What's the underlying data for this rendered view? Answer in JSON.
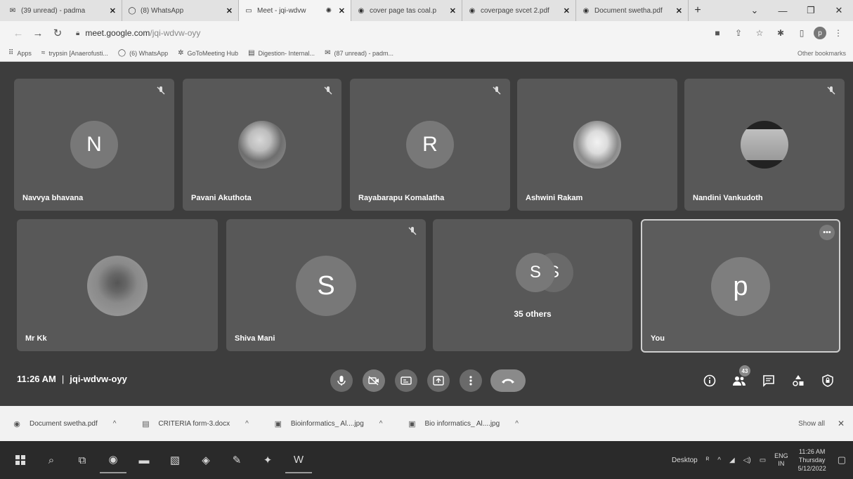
{
  "browser": {
    "tabs": [
      {
        "icon": "mail-icon",
        "label": "(39 unread) - padma",
        "close": "✕",
        "active": false
      },
      {
        "icon": "whatsapp-icon",
        "label": "(8) WhatsApp",
        "close": "✕",
        "active": false
      },
      {
        "icon": "meet-icon",
        "label": "Meet - jqi-wdvw",
        "close": "✕",
        "active": true
      },
      {
        "icon": "globe-icon",
        "label": "cover page tas coal.p",
        "close": "✕",
        "active": false
      },
      {
        "icon": "globe-icon",
        "label": "coverpage svcet 2.pdf",
        "close": "✕",
        "active": false
      },
      {
        "icon": "globe-icon",
        "label": "Document swetha.pdf",
        "close": "✕",
        "active": false
      }
    ],
    "new_tab": "+",
    "url_host": "meet.google.com",
    "url_path": "/jqi-wdvw-oyy",
    "profile_letter": "p",
    "bookmarks": [
      {
        "icon": "apps-icon",
        "label": "Apps"
      },
      {
        "icon": "link-icon",
        "label": "trypsin [Anaerofusti..."
      },
      {
        "icon": "whatsapp-icon",
        "label": "(6) WhatsApp"
      },
      {
        "icon": "gotomeeting-icon",
        "label": "GoToMeeting Hub"
      },
      {
        "icon": "doc-icon",
        "label": "Digestion- Internal..."
      },
      {
        "icon": "mail-icon",
        "label": "(87 unread) - padm..."
      }
    ],
    "other_bookmarks": "Other bookmarks"
  },
  "meet": {
    "participants": [
      {
        "name": "Navvya bhavana",
        "letter": "N",
        "type": "letter",
        "muted": true
      },
      {
        "name": "Pavani Akuthota",
        "letter": "",
        "type": "photo",
        "muted": true
      },
      {
        "name": "Rayabarapu Komalatha",
        "letter": "R",
        "type": "letter",
        "muted": true
      },
      {
        "name": "Ashwini Rakam",
        "letter": "",
        "type": "photo",
        "muted": false
      },
      {
        "name": "Nandini Vankudoth",
        "letter": "",
        "type": "photo",
        "muted": true
      },
      {
        "name": "Mr Kk",
        "letter": "",
        "type": "photo",
        "muted": false
      },
      {
        "name": "Shiva Mani",
        "letter": "S",
        "type": "letter",
        "muted": true
      }
    ],
    "others": {
      "letters": [
        "S",
        "S"
      ],
      "label": "35 others"
    },
    "self": {
      "name": "You",
      "letter": "p",
      "more": "•••"
    },
    "time": "11:26 AM",
    "separator": "|",
    "meeting_code": "jqi-wdvw-oyy",
    "people_count": "43"
  },
  "downloads": {
    "items": [
      {
        "icon": "chrome-icon",
        "label": "Document swetha.pdf"
      },
      {
        "icon": "word-doc-icon",
        "label": "CRITERIA form-3.docx"
      },
      {
        "icon": "image-file-icon",
        "label": "Bioinformatics_ Al....jpg"
      },
      {
        "icon": "image-file-icon",
        "label": "Bio informatics_ Al....jpg"
      }
    ],
    "show_all": "Show all",
    "close": "✕"
  },
  "taskbar": {
    "desktop_label": "Desktop",
    "lang_top": "ENG",
    "lang_bottom": "IN",
    "clock_time": "11:26 AM",
    "clock_day": "Thursday",
    "clock_date": "5/12/2022"
  },
  "colors": {
    "meet_bg": "#3d3d3d",
    "tile_bg": "#585858",
    "avatar_bg": "#787878",
    "taskbar_bg": "#2a2a2a"
  }
}
